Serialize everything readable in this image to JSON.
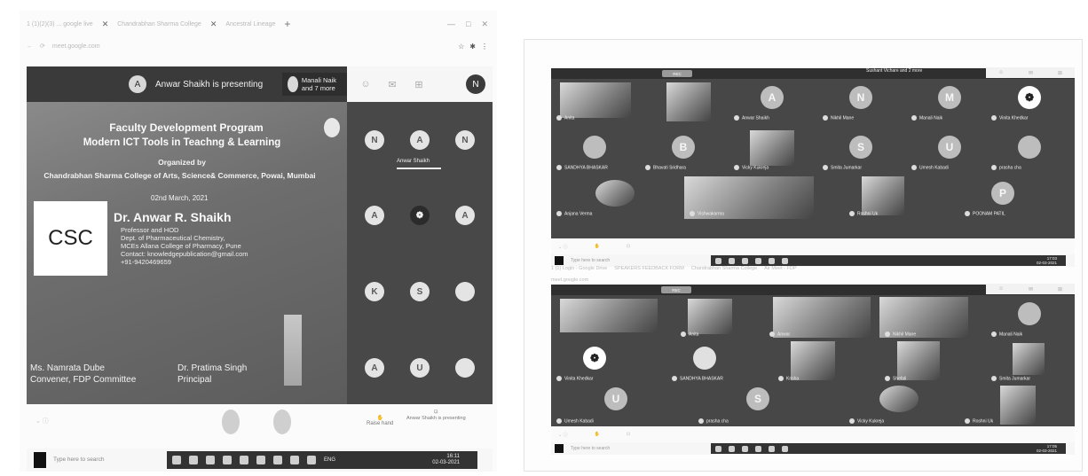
{
  "left_screen": {
    "browser": {
      "tabs": [
        "1 (1)(2)(3) ... google live",
        "Chandrabhan Sharma College",
        "Ancestral Lineage"
      ],
      "window_controls": [
        "—",
        "□",
        "✕"
      ],
      "address": "meet.google.com"
    },
    "meet": {
      "presenting_avatar": "A",
      "presenting_text": "Anwar Shaikh is presenting",
      "others_text": "Manali Naik and 7 more",
      "user_avatar": "N"
    },
    "slide": {
      "title_line1": "Faculty Development Program",
      "title_line2": "Modern ICT Tools in Teachng & Learning",
      "organized_by": "Organized by",
      "college": "Chandrabhan Sharma College of Arts, Science& Commerce, Powai, Mumbai",
      "date": "02nd March, 2021",
      "logo_text": "CSC",
      "speaker_name": "Dr. Anwar R. Shaikh",
      "speaker_role": "Professor and HOD",
      "speaker_dept": "Dept. of Pharmaceutical Chemistry,",
      "speaker_college": "MCEs Allana College of Pharmacy, Pune",
      "speaker_contact": "Contact: knowledgepublication@gmail.com",
      "speaker_phone": "+91-9420469659",
      "convener_name": "Ms. Namrata Dube",
      "convener_role": "Convener, FDP Committee",
      "principal_name": "Dr. Pratima Singh",
      "principal_role": "Principal"
    },
    "grid_tiles": [
      {
        "letter": "N"
      },
      {
        "letter": "A"
      },
      {
        "letter": "N"
      },
      {
        "letter": "A"
      },
      {
        "letter": "❁"
      },
      {
        "letter": "A"
      },
      {
        "letter": "K"
      },
      {
        "letter": "S"
      },
      {
        "letter": ""
      },
      {
        "letter": "A"
      },
      {
        "letter": "U"
      },
      {
        "letter": ""
      }
    ],
    "presenter_caption": "Anwar Shaikh",
    "controls": {
      "raise_hand": "Raise hand",
      "present_now": "Anwar Shaikh is presenting"
    },
    "taskbar": {
      "search": "Type here to search",
      "lang": "ENG",
      "time": "16:11",
      "date": "02-03-2021"
    }
  },
  "right_screen": {
    "top": {
      "rec": "REC",
      "others_text": "Sushant Vichare and 2 more",
      "tiles": [
        {
          "name": "Anita",
          "avatar": "",
          "photo": true
        },
        {
          "name": "",
          "avatar": "",
          "photo": true
        },
        {
          "name": "Anwar Shaikh",
          "avatar": "A",
          "photo": false
        },
        {
          "name": "Nikhil Mane",
          "avatar": "N",
          "photo": false
        },
        {
          "name": "Manali Naik",
          "avatar": "M",
          "photo": false
        },
        {
          "name": "Vinita Khedkar",
          "avatar": "❁",
          "photo": false
        },
        {
          "name": "SANDHYA BHASKAR",
          "avatar": "",
          "photo": false
        },
        {
          "name": "Bhavati Sridhara",
          "avatar": "B",
          "photo": false
        },
        {
          "name": "Vicky Kukreja",
          "avatar": "",
          "photo": true
        },
        {
          "name": "Smita Jumarkar",
          "avatar": "S",
          "photo": false
        },
        {
          "name": "Umesh Kabadi",
          "avatar": "U",
          "photo": false
        },
        {
          "name": "prasha cha",
          "avatar": "",
          "photo": false
        },
        {
          "name": "Anjana Verma",
          "avatar": "",
          "photo": true
        },
        {
          "name": "Vishwakarma",
          "avatar": "",
          "photo": true
        },
        {
          "name": "Roshni Uk",
          "avatar": "",
          "photo": true
        },
        {
          "name": "POONAM PATIL",
          "avatar": "P",
          "photo": false
        }
      ],
      "taskbar_search": "Type here to search",
      "time": "17:03",
      "date": "02-03-2021"
    },
    "bottom": {
      "tabs": [
        "1 (1) Login - Google Drive",
        "SPEAKERS FEEDBACK FORM",
        "Chandrabhan Sharma College",
        "Air Meet - FDP"
      ],
      "address": "meet.google.com",
      "rec": "REC",
      "tiles": [
        {
          "name": "Anita",
          "photo": true
        },
        {
          "name": "Anwar",
          "photo": true
        },
        {
          "name": "Nikhil Mane",
          "photo": true
        },
        {
          "name": "Manali Naik",
          "photo": false
        },
        {
          "name": "Vinita Khedkar",
          "photo": false
        },
        {
          "name": "SANDHYA BHASKAR",
          "photo": false
        },
        {
          "name": "Krisha",
          "photo": true
        },
        {
          "name": "Shefali",
          "photo": true
        },
        {
          "name": "Smita Jumarkar",
          "photo": true
        },
        {
          "name": "Umesh Kabadi",
          "avatar": "U",
          "photo": false
        },
        {
          "name": "prasha cha",
          "avatar": "S",
          "photo": false
        },
        {
          "name": "Vicky Kukreja",
          "photo": true
        },
        {
          "name": "Roshni Uk",
          "photo": true
        }
      ],
      "taskbar_search": "Type here to search",
      "time": "17:05",
      "date": "02-03-2021"
    }
  }
}
